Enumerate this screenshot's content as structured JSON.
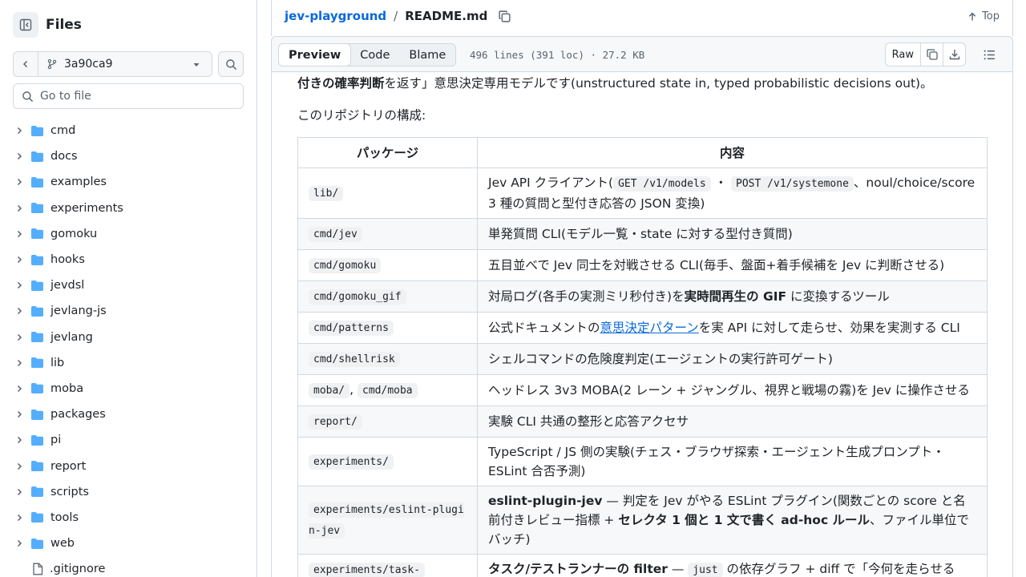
{
  "sidebar": {
    "title": "Files",
    "branch": "3a90ca9",
    "goto_placeholder": "Go to file",
    "folders": [
      "cmd",
      "docs",
      "examples",
      "experiments",
      "gomoku",
      "hooks",
      "jevdsl",
      "jevlang-js",
      "jevlang",
      "lib",
      "moba",
      "packages",
      "pi",
      "report",
      "scripts",
      "tools",
      "web"
    ],
    "files": [
      ".gitignore"
    ]
  },
  "header": {
    "repo": "jev-playground",
    "sep": "/",
    "file": "README.md",
    "top": "Top"
  },
  "toolbar": {
    "tabs": [
      "Preview",
      "Code",
      "Blame"
    ],
    "meta": "496 lines (391 loc) · 27.2 KB",
    "raw": "Raw"
  },
  "content": {
    "intro_bold": "付きの確率判断",
    "intro_rest": "を返す」意思決定専用モデルです(unstructured state in, typed probabilistic decisions out)。",
    "subtitle": "このリポジトリの構成:",
    "table_headers": [
      "パッケージ",
      "内容"
    ],
    "rows": {
      "r0": {
        "codes": [
          "lib/"
        ],
        "t1": "Jev API クライアント(",
        "c1": "GET /v1/models",
        "t2": " ・ ",
        "c2": "POST /v1/systemone",
        "t3": "、noul/choice/score 3 種の質問と型付き応答の JSON 変換)"
      },
      "r1": {
        "codes": [
          "cmd/jev"
        ],
        "text": "単発質問 CLI(モデル一覧・state に対する型付き質問)"
      },
      "r2": {
        "codes": [
          "cmd/gomoku"
        ],
        "text": "五目並べで Jev 同士を対戦させる CLI(毎手、盤面+着手候補を Jev に判断させる)"
      },
      "r3": {
        "codes": [
          "cmd/gomoku_gif"
        ],
        "t1": "対局ログ(各手の実測ミリ秒付き)を",
        "b1": "実時間再生の GIF",
        "t2": " に変換するツール"
      },
      "r4": {
        "codes": [
          "cmd/patterns"
        ],
        "t1": "公式ドキュメントの",
        "link": "意思決定パターン",
        "t2": "を実 API に対して走らせ、効果を実測する CLI"
      },
      "r5": {
        "codes": [
          "cmd/shellrisk"
        ],
        "text": "シェルコマンドの危険度判定(エージェントの実行許可ゲート)"
      },
      "r6": {
        "codes": [
          "moba/",
          "cmd/moba"
        ],
        "sep": ",",
        "text": "ヘッドレス 3v3 MOBA(2 レーン + ジャングル、視界と戦場の霧)を Jev に操作させる"
      },
      "r7": {
        "codes": [
          "report/"
        ],
        "text": "実験 CLI 共通の整形と応答アクセサ"
      },
      "r8": {
        "codes": [
          "experiments/"
        ],
        "text": "TypeScript / JS 側の実験(チェス・ブラウザ探索・エージェント生成プロンプト・ESLint 合否予測)"
      },
      "r9": {
        "codes": [
          "experiments/eslint-plugin-jev"
        ],
        "b1": "eslint-plugin-jev",
        "t1": " — 判定を Jev がやる ESLint プラグイン(関数ごとの score と名前付きレビュー指標 + ",
        "b2": "セレクタ 1 個と 1 文で書く ad-hoc ルール",
        "t2": "、ファイル単位でバッチ)"
      },
      "r10": {
        "codes": [
          "experiments/task-"
        ],
        "b1": "タスク/テストランナーの filter",
        "t1": " — ",
        "c1": "just",
        "t2": " の依存グラフ + diff で「今何を走らせる"
      }
    }
  }
}
